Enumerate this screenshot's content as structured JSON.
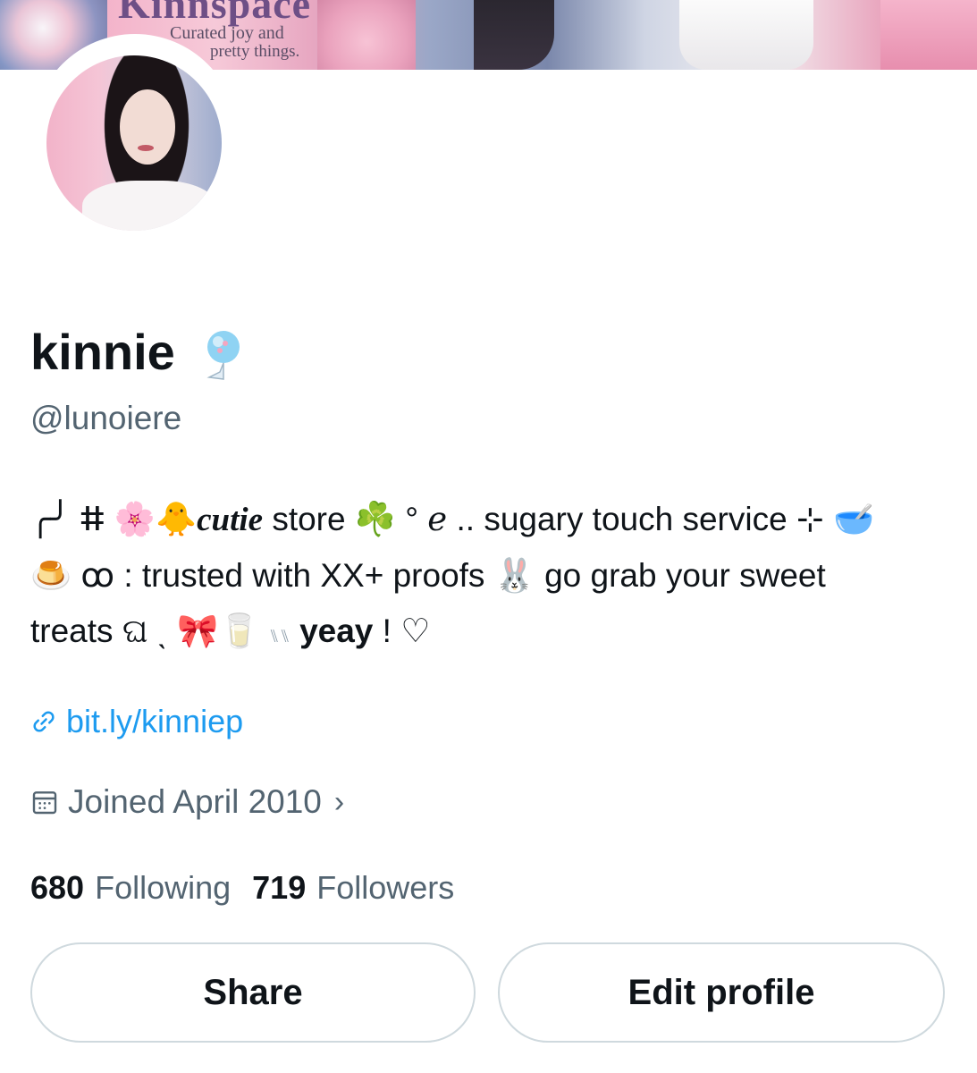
{
  "banner": {
    "title": "Kinnspace",
    "tagline_line1": "Curated joy and",
    "tagline_line2": "pretty things."
  },
  "profile": {
    "display_name": "kinnie",
    "handle": "@lunoiere",
    "name_badge_icon": "balloon-icon"
  },
  "bio": {
    "line1_prefix": "╭╯ ⵌ",
    "line1_emoji": "🌸🐥",
    "line1_italic": "cutie",
    "line1_text1": "store",
    "line1_emoji2": "☘️",
    "line1_text2": "° ℯ .. sugary touch service ⊹",
    "line1_emoji3": "🥣",
    "line2_emoji": "🍮",
    "line2_text1": "ꝏ : trusted with XX+ proofs",
    "line2_emoji2": "🐰",
    "line2_text2": "go grab your sweet",
    "line3_text1": "treats ଘ ˎ",
    "line3_emoji": "🎀🥛",
    "line3_text2": "⑊⑊",
    "line3_bold": "yeay",
    "line3_text3": "! ♡"
  },
  "link": {
    "text": "bit.ly/kinniep",
    "icon": "link-icon"
  },
  "joined": {
    "text": "Joined April 2010",
    "icon": "calendar-icon",
    "chevron": "›"
  },
  "stats": {
    "following_count": "680",
    "following_label": "Following",
    "followers_count": "719",
    "followers_label": "Followers"
  },
  "buttons": {
    "share_label": "Share",
    "edit_label": "Edit profile"
  },
  "colors": {
    "link": "#1d9bf0",
    "secondary_text": "#536471",
    "primary_text": "#0f1419",
    "button_border": "#cfd9de"
  }
}
